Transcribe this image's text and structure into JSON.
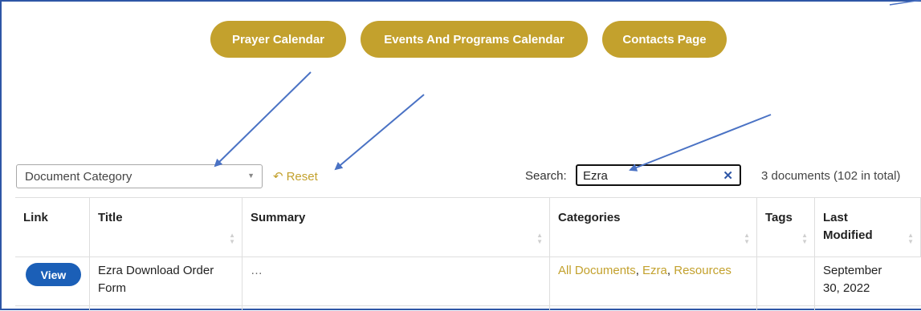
{
  "nav_buttons": {
    "prayer_calendar": "Prayer Calendar",
    "events_calendar": "Events And Programs Calendar",
    "contacts_page": "Contacts Page"
  },
  "filters": {
    "category_placeholder": "Document Category",
    "reset_label": "Reset",
    "search_label": "Search:",
    "search_value": "Ezra",
    "count_text": "3 documents (102 in total)"
  },
  "table": {
    "headers": [
      "Link",
      "Title",
      "Summary",
      "Categories",
      "Tags",
      "Last Modified"
    ],
    "rows": [
      {
        "link": "View",
        "title": "Ezra Download Order Form",
        "summary": "…",
        "categories": [
          "All Documents",
          "Ezra",
          "Resources"
        ],
        "tags": "",
        "last_modified": "September 30, 2022"
      }
    ]
  },
  "colors": {
    "gold_accent": "#c3a12d",
    "view_button_blue": "#1b5fb7",
    "annotation_arrow_blue": "#4a72c4"
  }
}
